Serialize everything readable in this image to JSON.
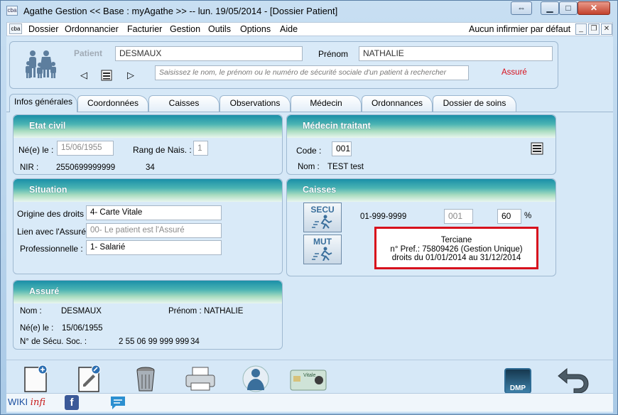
{
  "window": {
    "title": "Agathe Gestion << Base : myAgathe >>   --   lun. 19/05/2014  - [Dossier Patient]",
    "app_icon_text": "cba"
  },
  "menu": {
    "items": [
      "Dossier",
      "Ordonnancier",
      "Facturier",
      "Gestion",
      "Outils",
      "Options",
      "Aide"
    ],
    "nurse_label": "Aucun infirmier par défaut"
  },
  "patient": {
    "label": "Patient",
    "nom": "DESMAUX",
    "prenom_label": "Prénom",
    "prenom": "NATHALIE",
    "search_placeholder": "Saisissez le nom, le prénom ou le numéro de sécurité sociale d'un patient à rechercher",
    "assure": "Assuré"
  },
  "tabs": [
    "Infos générales",
    "Coordonnées",
    "Caisses",
    "Observations",
    "Médecin",
    "Ordonnances",
    "Dossier de soins"
  ],
  "etat_civil": {
    "title": "Etat civil",
    "naissance_label": "Né(e) le :",
    "naissance": "15/06/1955",
    "rang_label": "Rang de Nais. :",
    "rang": "1",
    "nir_label": "NIR :",
    "nir": "2550699999999",
    "nir_key": "34"
  },
  "medecin": {
    "title": "Médecin traitant",
    "code_label": "Code :",
    "code": "001",
    "nom_label": "Nom :",
    "nom": "TEST test"
  },
  "situation": {
    "title": "Situation",
    "origine_label": "Origine des droits :",
    "origine": "4- Carte Vitale",
    "lien_label": "Lien avec l'Assuré :",
    "lien": "00- Le patient est l'Assuré",
    "pro_label": "Professionnelle :",
    "pro": "1- Salarié"
  },
  "caisses": {
    "title": "Caisses",
    "secu_label": "SECU",
    "mut_label": "MUT",
    "caisse_code": "01-999-9999",
    "centre": "001",
    "taux": "60",
    "pct": "%",
    "mut_name": "Terciane",
    "mut_pref": "n° Pref.: 75809426 (Gestion Unique)",
    "mut_droits": "droits du 01/01/2014 au 31/12/2014"
  },
  "assure": {
    "title": "Assuré",
    "nom_label": "Nom :",
    "nom": "DESMAUX",
    "prenom_label": "Prénom :",
    "prenom": "NATHALIE",
    "naissance_label": "Né(e) le :",
    "naissance": "15/06/1955",
    "secu_label": "N° de Sécu. Soc. :",
    "secu": "2 55 06 99 999 999",
    "secu_key": "34"
  },
  "toolbar": {
    "dmp_label": "DMP",
    "card_text": "Vitale"
  },
  "status": {
    "wiki": "WIKI",
    "infi": "infi"
  },
  "colors": {
    "header_teal": "#1a8fa8",
    "highlight_red": "#d7111d",
    "assure_red": "#d7111d"
  }
}
